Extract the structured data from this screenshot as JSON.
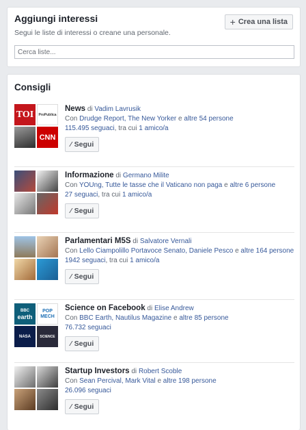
{
  "header": {
    "title": "Aggiungi interessi",
    "subtitle": "Segui le liste di interessi o creane una personale.",
    "create_button": "Crea una lista",
    "search_placeholder": "Cerca liste..."
  },
  "recommendations": {
    "title": "Consigli",
    "follow_label": "Segui",
    "items": [
      {
        "title": "News",
        "by": "di",
        "author": "Vadim Lavrusik",
        "con": "Con",
        "members": "Drudge Report, The New Yorker",
        "e": "e",
        "others": "altre 54 persone",
        "followers": "115.495 seguaci",
        "tra": ", tra cui",
        "friends": "1 amico/a"
      },
      {
        "title": "Informazione",
        "by": "di",
        "author": "Germano Milite",
        "con": "Con",
        "members": "YOUng, Tutte le tasse che il Vaticano non paga",
        "e": "e",
        "others": "altre 6 persone",
        "followers": "27 seguaci",
        "tra": ", tra cui",
        "friends": "1 amico/a"
      },
      {
        "title": "Parlamentari M5S",
        "by": "di",
        "author": "Salvatore Vernali",
        "con": "Con",
        "members": "Lello Ciampolillo Portavoce Senato, Daniele Pesco",
        "e": "e",
        "others": "altre 164 persone",
        "followers": "1942 seguaci",
        "tra": ", tra cui",
        "friends": "1 amico/a"
      },
      {
        "title": "Science on Facebook",
        "by": "di",
        "author": "Elise Andrew",
        "con": "Con",
        "members": "BBC Earth, Nautilus Magazine",
        "e": "e",
        "others": "altre 85 persone",
        "followers": "76.732 seguaci",
        "tra": "",
        "friends": ""
      },
      {
        "title": "Startup Investors",
        "by": "di",
        "author": "Robert Scoble",
        "con": "Con",
        "members": "Sean Percival, Mark Vital",
        "e": "e",
        "others": "altre 198 persone",
        "followers": "26.096 seguaci",
        "tra": "",
        "friends": ""
      }
    ]
  },
  "logo_text": {
    "toi": "TOI",
    "propublica": "ProPublica",
    "cnn": "CNN",
    "bbc": "BBC",
    "earth": "earth",
    "pop": "POP",
    "mech": "MECH",
    "nasa": "NASA",
    "science": "SCIENCE"
  }
}
